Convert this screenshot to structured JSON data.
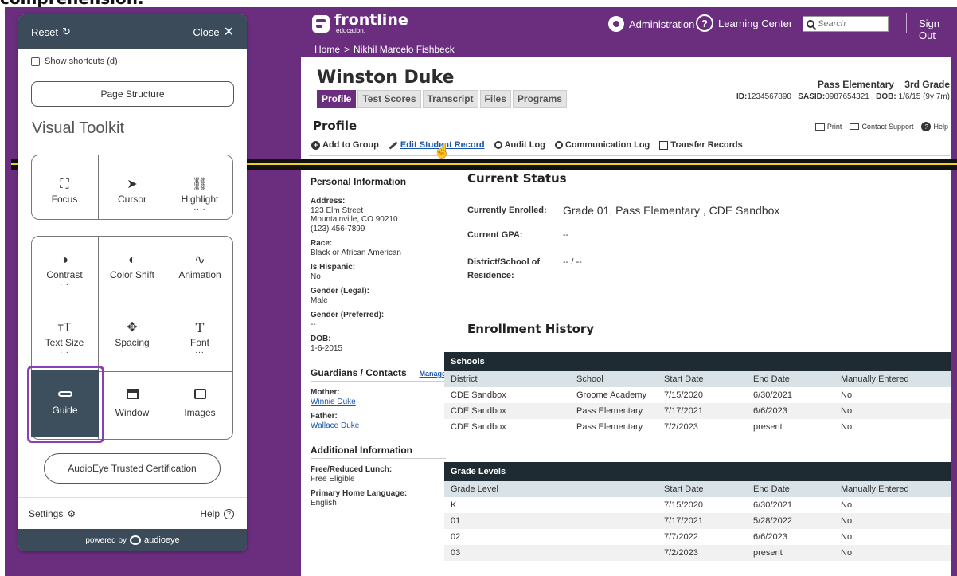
{
  "caption": "comprehension.",
  "header": {
    "brand": "frontline",
    "brand_sub": "education.",
    "breadcrumb_home": "Home",
    "breadcrumb_sep": ">",
    "breadcrumb_current": "Nikhil Marcelo Fishbeck",
    "administration": "Administration",
    "learning_center": "Learning Center",
    "search_placeholder": "Search",
    "sign_out": "Sign Out"
  },
  "student": {
    "name": "Winston Duke",
    "tabs": [
      {
        "label": "Profile",
        "active": true
      },
      {
        "label": "Test Scores",
        "active": false
      },
      {
        "label": "Transcript",
        "active": false
      },
      {
        "label": "Files",
        "active": false
      },
      {
        "label": "Programs",
        "active": false
      }
    ],
    "school": "Pass Elementary",
    "grade": "3rd Grade",
    "id_label": "ID:",
    "id": "1234567890",
    "sasid_label": "SASID:",
    "sasid": "0987654321",
    "dob_label": "DOB:",
    "dob": "1/6/15 (9y 7m)"
  },
  "profile": {
    "title": "Profile",
    "print": "Print",
    "contact_support": "Contact Support",
    "help": "Help",
    "actions": {
      "add_group": "Add to Group",
      "edit_record": "Edit Student Record",
      "audit_log": "Audit Log",
      "communication_log": "Communication Log",
      "transfer_records": "Transfer Records"
    }
  },
  "personal": {
    "title": "Personal Information",
    "address_label": "Address:",
    "address_1": "123 Elm Street",
    "address_2": "Mountainville, CO 90210",
    "phone": "(123) 456-7899",
    "race_label": "Race:",
    "race": "Black or African American",
    "hispanic_label": "Is Hispanic:",
    "hispanic": "No",
    "gender_legal_label": "Gender (Legal):",
    "gender_legal": "Male",
    "gender_pref_label": "Gender (Preferred):",
    "gender_pref": "--",
    "dob_label": "DOB:",
    "dob": "1-6-2015"
  },
  "guardians": {
    "title": "Guardians / Contacts",
    "manage": "Manage",
    "mother_label": "Mother:",
    "mother": "Winnie Duke",
    "father_label": "Father:",
    "father": "Wallace Duke"
  },
  "additional": {
    "title": "Additional Information",
    "lunch_label": "Free/Reduced Lunch:",
    "lunch": "Free Eligible",
    "language_label": "Primary Home Language:",
    "language": "English"
  },
  "status": {
    "title": "Current Status",
    "enrolled_label": "Currently Enrolled:",
    "enrolled": "Grade 01, Pass Elementary , CDE Sandbox",
    "gpa_label": "Current GPA:",
    "gpa": "--",
    "residence_label_1": "District/School of",
    "residence_label_2": "Residence:",
    "residence": "-- / --"
  },
  "enrollment": {
    "title": "Enrollment History",
    "schools": {
      "caption": "Schools",
      "columns": [
        "District",
        "School",
        "Start Date",
        "End Date",
        "Manually Entered"
      ],
      "rows": [
        [
          "CDE Sandbox",
          "Groome Academy",
          "7/15/2020",
          "6/30/2021",
          "No"
        ],
        [
          "CDE Sandbox",
          "Pass Elementary",
          "7/17/2021",
          "6/6/2023",
          "No"
        ],
        [
          "CDE Sandbox",
          "Pass Elementary",
          "7/2/2023",
          "present",
          "No"
        ]
      ]
    },
    "grades": {
      "caption": "Grade Levels",
      "columns": [
        "Grade Level",
        "Start Date",
        "End Date",
        "Manually Entered"
      ],
      "rows": [
        [
          "K",
          "7/15/2020",
          "6/30/2021",
          "No"
        ],
        [
          "01",
          "7/17/2021",
          "5/28/2022",
          "No"
        ],
        [
          "02",
          "7/7/2022",
          "6/6/2023",
          "No"
        ],
        [
          "03",
          "7/2/2023",
          "present",
          "No"
        ]
      ]
    }
  },
  "toolkit": {
    "reset": "Reset",
    "close": "Close",
    "show_shortcuts": "Show shortcuts (d)",
    "page_structure": "Page Structure",
    "title": "Visual Toolkit",
    "tools": {
      "focus": "Focus",
      "cursor": "Cursor",
      "highlight": "Highlight",
      "contrast": "Contrast",
      "color_shift": "Color Shift",
      "animation": "Animation",
      "text_size": "Text Size",
      "spacing": "Spacing",
      "font": "Font",
      "guide": "Guide",
      "window": "Window",
      "images": "Images"
    },
    "dots": "...",
    "certification": "AudioEye Trusted Certification",
    "settings": "Settings",
    "help": "Help",
    "powered_by": "powered by",
    "brand": "audioeye"
  },
  "colors": {
    "frame": "#6b2d7e",
    "panel_dark": "#3c4b59",
    "guide_outline": "#8a3fb6",
    "guide_line": "#f0d023",
    "table_caption": "#1f2b33"
  }
}
